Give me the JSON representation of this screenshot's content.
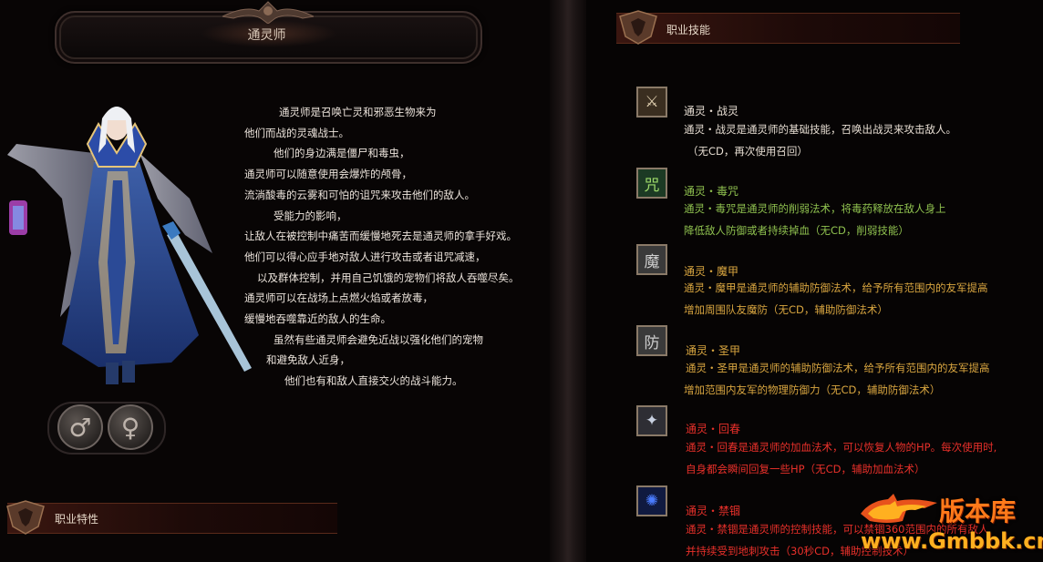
{
  "header": {
    "title": "通灵师"
  },
  "character": {
    "lore_lines": [
      "通灵师是召唤亡灵和邪恶生物来为",
      "他们而战的灵魂战士。",
      "他们的身边满是僵尸和毒虫，",
      "通灵师可以随意使用会爆炸的颅骨，",
      "流淌酸毒的云雾和可怕的诅咒来攻击他们的敌人。",
      "受能力的影响，",
      "让敌人在被控制中痛苦而缓慢地死去是通灵师的拿手好戏。",
      "他们可以得心应手地对敌人进行攻击或者诅咒减速，",
      "以及群体控制，并用自己饥饿的宠物们将敌人吞噬尽矣。",
      "通灵师可以在战场上点燃火焰或者放毒，",
      "缓慢地吞噬靠近的敌人的生命。",
      "虽然有些通灵师会避免近战以强化他们的宠物",
      "和避免敌人近身，",
      "他们也有和敌人直接交火的战斗能力。"
    ],
    "gender_buttons": {
      "male": "♂",
      "female": "♀"
    }
  },
  "traits_section": {
    "label": "职业特性"
  },
  "skills_section": {
    "label": "职业技能",
    "skills": [
      {
        "name": "通灵・战灵",
        "icon_name": "war-spirit-icon",
        "glyph": "⚔",
        "color": "#e6ddd2",
        "desc": [
          "通灵・战灵是通灵师的基础技能，召唤出战灵来攻击敌人。",
          "（无CD，再次使用召回）"
        ]
      },
      {
        "name": "通灵・毒咒",
        "icon_name": "poison-curse-icon",
        "glyph": "咒",
        "color": "#8fc14f",
        "desc": [
          "通灵・毒咒是通灵师的削弱法术，将毒药释放在敌人身上",
          "降低敌人防御或者持续掉血（无CD，削弱技能）"
        ]
      },
      {
        "name": "通灵・魔甲",
        "icon_name": "magic-armor-icon",
        "glyph": "魔",
        "color": "#d9a640",
        "desc": [
          "通灵・魔甲是通灵师的辅助防御法术，给予所有范围内的友军提高",
          "增加周围队友魔防（无CD，辅助防御法术）"
        ]
      },
      {
        "name": "通灵・圣甲",
        "icon_name": "holy-armor-icon",
        "glyph": "防",
        "color": "#d9a640",
        "desc": [
          "通灵・圣甲是通灵师的辅助防御法术，给予所有范围内的友军提高",
          "增加范围内友军的物理防御力（无CD，辅助防御法术）"
        ]
      },
      {
        "name": "通灵・回春",
        "icon_name": "rejuvenate-icon",
        "glyph": "✦",
        "color": "#e8302a",
        "desc": [
          "通灵・回春是通灵师的加血法术，可以恢复人物的HP。每次使用时,",
          "自身都会瞬间回复一些HP（无CD，辅助加血法术）"
        ]
      },
      {
        "name": "通灵・禁锢",
        "icon_name": "imprison-icon",
        "glyph": "✺",
        "color": "#e8302a",
        "desc": [
          "通灵・禁锢是通灵师的控制技能，可以禁锢360范围内的所有敌人",
          "并持续受到地刺攻击（30秒CD，辅助控制技术）"
        ]
      }
    ]
  },
  "watermark": {
    "brand": "版本库",
    "url": "www.Gmbbk.cn"
  }
}
